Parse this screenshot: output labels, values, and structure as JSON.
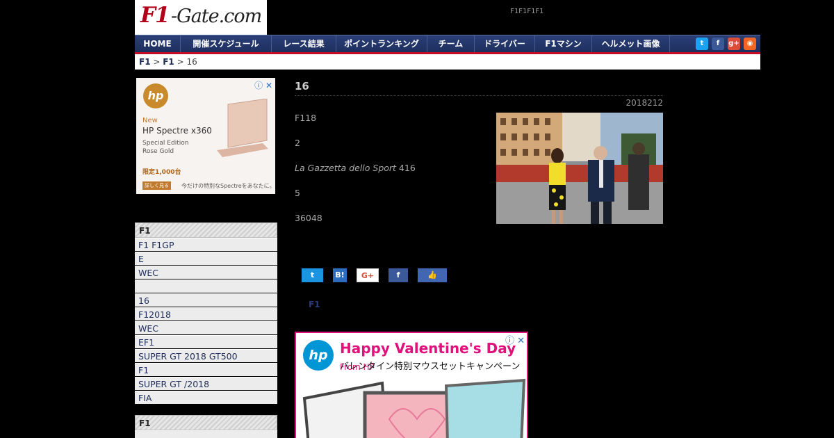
{
  "header": {
    "logo_part1": "F1",
    "logo_part2": "-Gate.com",
    "tagline": "F1F1F1F1"
  },
  "nav": {
    "items": [
      {
        "label": "HOME"
      },
      {
        "label": "開催スケジュール"
      },
      {
        "label": "レース結果"
      },
      {
        "label": "ポイントランキング"
      },
      {
        "label": "チーム"
      },
      {
        "label": "ドライバー"
      },
      {
        "label": "F1マシン"
      },
      {
        "label": "ヘルメット画像"
      }
    ],
    "social": [
      {
        "name": "twitter-icon",
        "glyph": "t",
        "color": "#1da1f2"
      },
      {
        "name": "facebook-icon",
        "glyph": "f",
        "color": "#3b5998"
      },
      {
        "name": "googleplus-icon",
        "glyph": "g+",
        "color": "#dd4b39"
      },
      {
        "name": "rss-icon",
        "glyph": "◉",
        "color": "#f26522"
      }
    ]
  },
  "breadcrumb": {
    "crumb1": "F1",
    "sep1": " > ",
    "crumb2": "F1",
    "sep2": " > ",
    "current": "16"
  },
  "ad_left": {
    "logo": "hp",
    "new": "New",
    "product": "HP Spectre x360",
    "edition_line1": "Special Edition",
    "edition_line2": "Rose Gold",
    "limited": "限定1,000台",
    "cta": "詳しく見る",
    "tagline": "今だけの特別なSpectreをあなたに。"
  },
  "sidebar1": {
    "heading": "F1",
    "items": [
      "F1 F1GP",
      "E",
      "WEC",
      "",
      "16",
      "F12018",
      "WEC",
      " EF1",
      "SUPER GT 2018 GT500",
      "F1",
      "SUPER GT /2018",
      "FIA"
    ]
  },
  "sidebar2": {
    "heading": "F1"
  },
  "article": {
    "title": "16",
    "date": "2018212",
    "p1": "F118",
    "p2": "2",
    "p3_italic": "La Gazzetta dello Sport",
    "p3_rest": " 416",
    "p4": "5",
    "p5": "36048"
  },
  "share": {
    "twitter": "t",
    "hatena": "B!",
    "gplus": "G+",
    "facebook": "f",
    "like": "👍"
  },
  "tag": "F1",
  "ad_main": {
    "logo": "hp",
    "headline": "Happy Valentine's Day",
    "from": " From HP",
    "subline": "バレンタイン特別マウスセットキャンペーン"
  }
}
